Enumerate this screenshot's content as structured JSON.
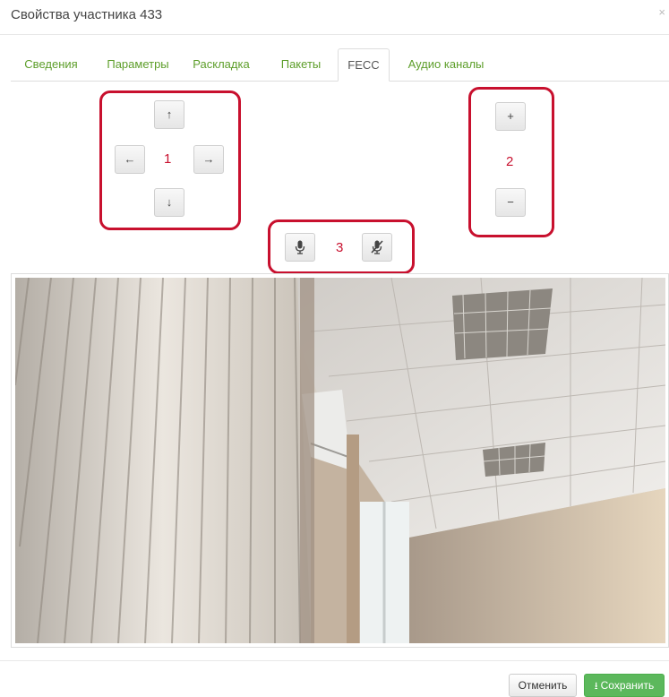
{
  "dialog": {
    "title": "Свойства участника 433",
    "close_glyph": "×"
  },
  "tabs": [
    {
      "label": "Сведения",
      "active": false
    },
    {
      "label": "Параметры",
      "active": false
    },
    {
      "label": "Раскладка",
      "active": false
    },
    {
      "label": "Пакеты",
      "active": false
    },
    {
      "label": "FECC",
      "active": true
    },
    {
      "label": "Аудио каналы",
      "active": false
    }
  ],
  "fecc": {
    "pan_tilt": {
      "up": "↑",
      "left": "←",
      "right": "→",
      "down": "↓",
      "annotation": "1"
    },
    "zoom": {
      "in": "+",
      "out": "−",
      "annotation": "2"
    },
    "audio": {
      "mic_icon": "microphone-icon",
      "mute_icon": "microphone-muted-icon",
      "annotation": "3"
    },
    "annotation_color": "#c8102e"
  },
  "footer": {
    "cancel_label": "Отменить",
    "save_label": "Сохранить",
    "save_icon": "upload-icon"
  },
  "colors": {
    "tab_link": "#5d9e2a",
    "save_button": "#5cb85c"
  }
}
